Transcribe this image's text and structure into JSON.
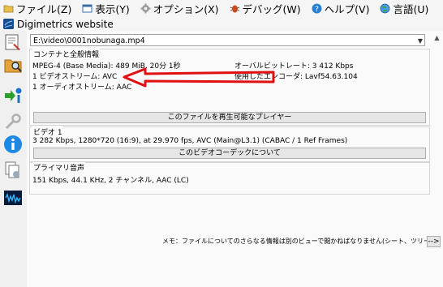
{
  "menu": [
    {
      "label": "ファイル(Z)",
      "icon": "folder-icon"
    },
    {
      "label": "表示(Y)",
      "icon": "view-icon"
    },
    {
      "label": "オプション(X)",
      "icon": "gear-icon"
    },
    {
      "label": "デバッグ(W)",
      "icon": "bug-icon"
    },
    {
      "label": "ヘルプ(V)",
      "icon": "help-icon"
    },
    {
      "label": "言語(U)",
      "icon": "globe-icon"
    }
  ],
  "website": {
    "label": "Digimetrics website"
  },
  "file": {
    "path": "E:\\video\\0001nobunaga.mp4"
  },
  "general": {
    "title": "コンテナと全般情報",
    "format": "MPEG-4 (Base Media): 489 MiB, 20分 1秒",
    "video_streams": "1 ビデオストリーム: AVC",
    "audio_streams": "1 オーディオストリーム: AAC",
    "bitrate": "オーバルビットレート: 3 412 Kbps",
    "encoder": "使用したエンコーダ: Lavf54.63.104",
    "players_button": "このファイルを再生可能なプレイヤー"
  },
  "video": {
    "title": "ビデオ 1",
    "details": "3 282 Kbps, 1280*720 (16:9), at 29.970 fps, AVC (Main@L3.1) (CABAC / 1 Ref Frames)",
    "codec_button": "このビデオコーデックについて"
  },
  "audio": {
    "title": "プライマリ音声",
    "details": "151 Kbps, 44.1 KHz, 2 チャンネル, AAC (LC)"
  },
  "note": "メモ：ファイルについてのさらなる情報は別のビューで閲かねばなりません(シート、ツリー...)",
  "more_button": "-->",
  "annotation_color": "#e01010"
}
